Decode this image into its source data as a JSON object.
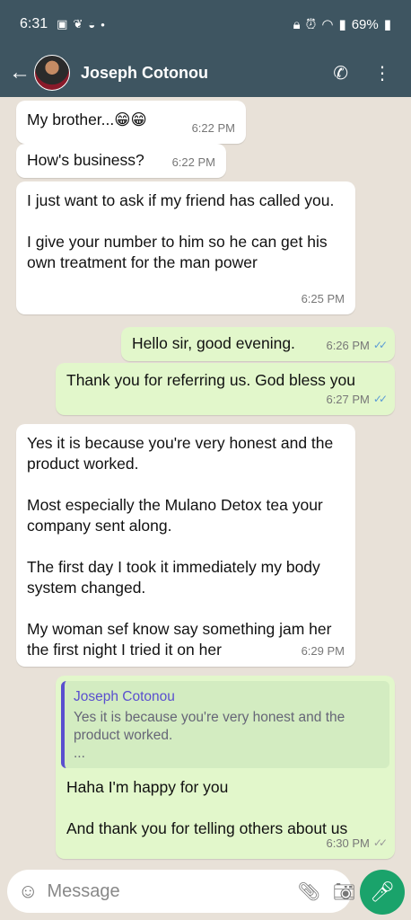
{
  "status_bar": {
    "time": "6:31",
    "battery": "69%"
  },
  "header": {
    "contact_name": "Joseph Cotonou"
  },
  "messages": [
    {
      "dir": "in",
      "text": "My brother...😁😁",
      "time": "6:22 PM"
    },
    {
      "dir": "in",
      "text": "How's business?",
      "time": "6:22 PM"
    },
    {
      "dir": "in",
      "text": "I just want to ask if my friend has called you.\n\nI give your number to him so he can get his own treatment for the man power",
      "time": "6:25 PM"
    },
    {
      "dir": "out",
      "text": "Hello sir, good evening.",
      "time": "6:26 PM",
      "status": "read"
    },
    {
      "dir": "out",
      "text": "Thank you for referring us. God bless you",
      "time": "6:27 PM",
      "status": "read"
    },
    {
      "dir": "in",
      "text": "Yes it is because you're very honest and the product worked.\n\nMost especially the Mulano Detox tea your company sent along.\n\nThe first day I took it immediately my body system changed.\n\nMy woman sef know say something jam her the first night I tried it on her",
      "time": "6:29 PM"
    },
    {
      "dir": "out",
      "quote_name": "Joseph Cotonou",
      "quote_text": "Yes it is because you're very honest and the product worked.\n...",
      "text": "Haha I'm happy for you\n\nAnd thank you for telling others about us",
      "time": "6:30 PM",
      "status": "delivered"
    }
  ],
  "input": {
    "placeholder": "Message"
  }
}
